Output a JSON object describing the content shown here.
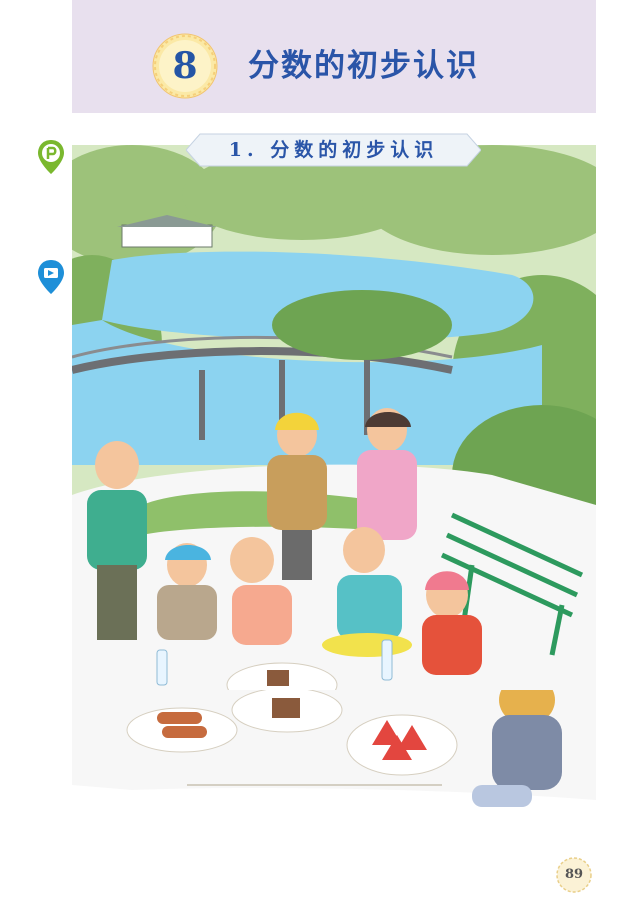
{
  "chapter": {
    "number": "8",
    "title": "分数的初步认识"
  },
  "section": {
    "title": "1. 分数的初步认识"
  },
  "side_icons": [
    {
      "name": "green-pin-icon",
      "color": "#7ab82e"
    },
    {
      "name": "blue-pin-icon",
      "color": "#1e8fd8"
    }
  ],
  "illustration": {
    "name": "children-picnic-by-lake-illustration"
  },
  "footer": {
    "page_number": "89"
  },
  "colors": {
    "banner_bg": "#e8e0ee",
    "title_blue": "#2a55a8",
    "badge_yellow": "#fbe9a6",
    "lake_blue": "#8cd3f0"
  }
}
